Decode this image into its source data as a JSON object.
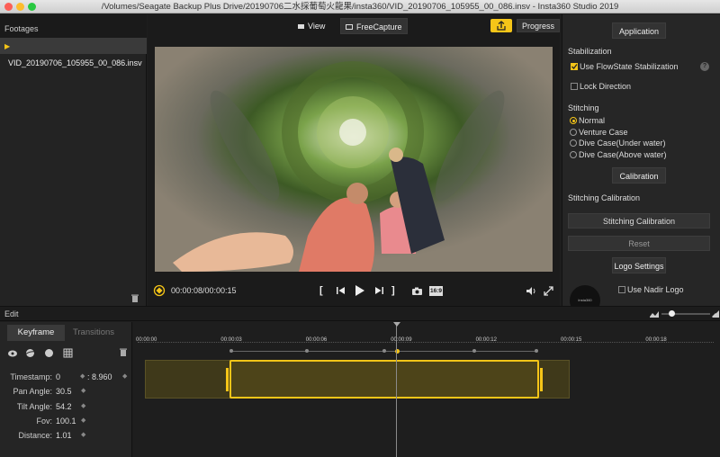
{
  "window": {
    "title": "/Volumes/Seagate Backup Plus Drive/20190706二水採葡萄火龍果/insta360/VID_20190706_105955_00_086.insv - Insta360 Studio 2019"
  },
  "footages": {
    "header": "Footages",
    "items": [
      {
        "label": "VID_20190706_105955_00_086.insv"
      }
    ]
  },
  "viewer": {
    "view_label": "View",
    "freecapture_label": "FreeCapture",
    "progress_label": "Progress",
    "timecode": "00:00:08/00:00:15",
    "aspect_label": "16:9"
  },
  "panel": {
    "application_label": "Application",
    "stabilization_title": "Stabilization",
    "use_flowstate": "Use FlowState Stabilization",
    "help": "?",
    "lock_direction": "Lock Direction",
    "stitching_title": "Stitching",
    "stitching_options": [
      {
        "label": "Normal",
        "selected": true
      },
      {
        "label": "Venture Case"
      },
      {
        "label": "Dive Case(Under water)"
      },
      {
        "label": "Dive Case(Above water)"
      }
    ],
    "calibration_label": "Calibration",
    "stitching_calibration_title": "Stitching Calibration",
    "stitching_calibration_button": "Stitching Calibration",
    "reset_button": "Reset",
    "logo_settings_label": "Logo Settings",
    "use_nadir_logo": "Use Nadir Logo",
    "logo_text": "Insta360"
  },
  "edit": {
    "label": "Edit",
    "zoom_level": 0.2
  },
  "tabs": {
    "keyframe": "Keyframe",
    "transitions": "Transitions"
  },
  "props": {
    "timestamp_label": "Timestamp:",
    "timestamp_value": "0",
    "timestamp_end": ": 8.960",
    "pan_label": "Pan Angle:",
    "pan_value": "30.5",
    "tilt_label": "Tilt Angle:",
    "tilt_value": "54.2",
    "fov_label": "Fov:",
    "fov_value": "100.1",
    "distance_label": "Distance:",
    "distance_value": "1.01"
  },
  "timeline": {
    "ticks": [
      "00:00:00",
      "00:00:03",
      "00:00:06",
      "00:00:09",
      "00:00:12",
      "00:00:15",
      "00:00:18"
    ]
  },
  "colors": {
    "accent": "#f5c518",
    "bg": "#1e1e1e",
    "panel": "#262626"
  }
}
